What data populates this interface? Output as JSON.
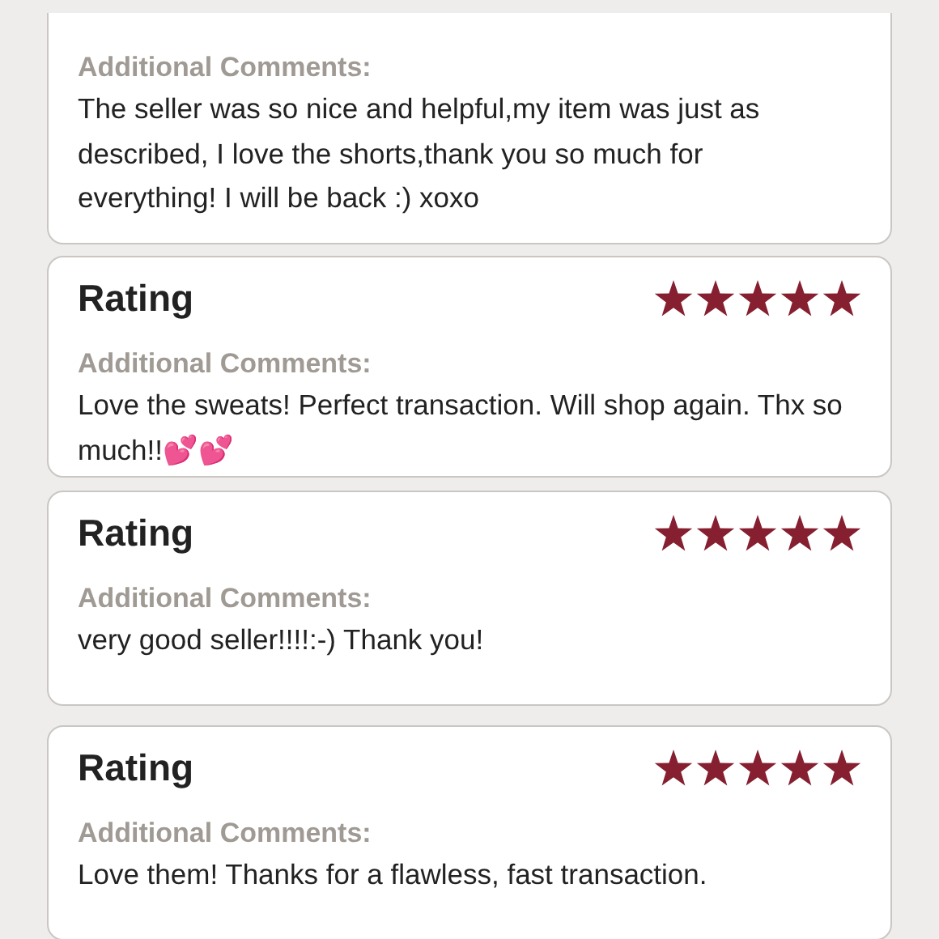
{
  "reviews": [
    {
      "comments_label": "Additional Comments:",
      "comment": "The seller was so nice and helpful,my item was just as described, I love the shorts,thank you so much for everything! I will be back :) xoxo"
    },
    {
      "rating_label": "Rating",
      "stars": 5,
      "comments_label": "Additional Comments:",
      "comment": "Love the sweats! Perfect transaction. Will shop again. Thx so much!!💕💕"
    },
    {
      "rating_label": "Rating",
      "stars": 5,
      "comments_label": "Additional Comments:",
      "comment": "very good seller!!!!:-) Thank you!"
    },
    {
      "rating_label": "Rating",
      "stars": 5,
      "comments_label": "Additional Comments:",
      "comment": "Love them! Thanks for a flawless, fast transaction."
    }
  ]
}
